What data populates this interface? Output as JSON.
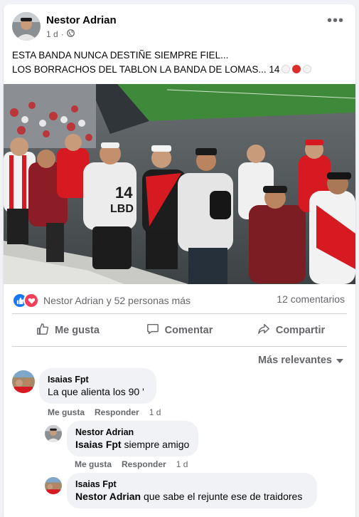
{
  "post": {
    "author": "Nestor Adrian",
    "time": "1 d",
    "privacy_separator": "·",
    "more_label": "•••",
    "text_line1": "ESTA BANDA NUNCA DESTIÑE SIEMPRE FIEL...",
    "text_line2": "LOS BORRACHOS DEL TABLON LA BANDA DE LOMAS... 14",
    "shirt_text": "14",
    "shirt_text2": "LBD"
  },
  "stats": {
    "reactions_text": "Nestor Adrian y 52 personas más",
    "comments_text": "12 comentarios"
  },
  "actions": {
    "like": "Me gusta",
    "comment": "Comentar",
    "share": "Compartir"
  },
  "sort": {
    "label": "Más relevantes"
  },
  "comments": [
    {
      "author": "Isaias Fpt",
      "mention": "",
      "text": "La que alienta los 90 '",
      "like": "Me gusta",
      "reply": "Responder",
      "time": "1 d"
    },
    {
      "author": "Nestor Adrian",
      "mention": "Isaias Fpt",
      "text": " siempre amigo",
      "like": "Me gusta",
      "reply": "Responder",
      "time": "1 d"
    },
    {
      "author": "Isaias Fpt",
      "mention": "Nestor Adrian",
      "text": " que sabe el rejunte ese de traidores"
    }
  ],
  "colors": {
    "like_blue": "#1877f2",
    "love_red": "#f33e58",
    "river_red": "#d71921"
  }
}
